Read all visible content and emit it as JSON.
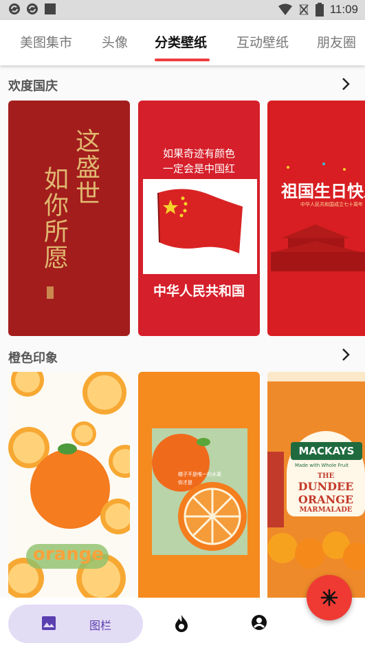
{
  "status_bar": {
    "time": "11:09",
    "left_icons": [
      "sync-icon",
      "sync-icon",
      "square-icon"
    ],
    "right_icons": [
      "wifi-icon",
      "no-signal-icon",
      "battery-icon"
    ]
  },
  "tabs": [
    {
      "label": "美图集市",
      "active": false
    },
    {
      "label": "头像",
      "active": false
    },
    {
      "label": "分类壁纸",
      "active": true
    },
    {
      "label": "互动壁纸",
      "active": false
    },
    {
      "label": "朋友圈",
      "active": false
    }
  ],
  "accent_color": "#ee3d3d",
  "sections": [
    {
      "title": "欢度国庆",
      "cards": [
        {
          "text_lines": [
            "这盛世",
            "如你所愿"
          ]
        },
        {
          "text_lines": [
            "如果奇迹有颜色",
            "一定会是中国红"
          ],
          "caption": "中华人民共和国"
        },
        {
          "text_lines": [
            "祖国生日快乐"
          ],
          "subtext": "中华人民共和国成立七十周年"
        }
      ]
    },
    {
      "title": "橙色印象",
      "cards": [
        {
          "text_lines": [
            "orange"
          ]
        },
        {
          "text_lines": [
            "橘子不是唯一的水果",
            "你才是"
          ]
        },
        {
          "text_lines": [
            "MACKAYS",
            "Made with Whole Fruit",
            "THE",
            "DUNDEE",
            "ORANGE",
            "MARMALADE"
          ]
        }
      ]
    }
  ],
  "bottom_nav": {
    "items": [
      {
        "label": "图栏",
        "icon": "image-icon",
        "active": true
      },
      {
        "label": "",
        "icon": "flame-icon",
        "active": false
      },
      {
        "label": "",
        "icon": "account-icon",
        "active": false
      }
    ],
    "active_color": "#e3dcf5"
  },
  "fab": {
    "icon": "snowflake-icon",
    "color": "#ee3a33"
  }
}
